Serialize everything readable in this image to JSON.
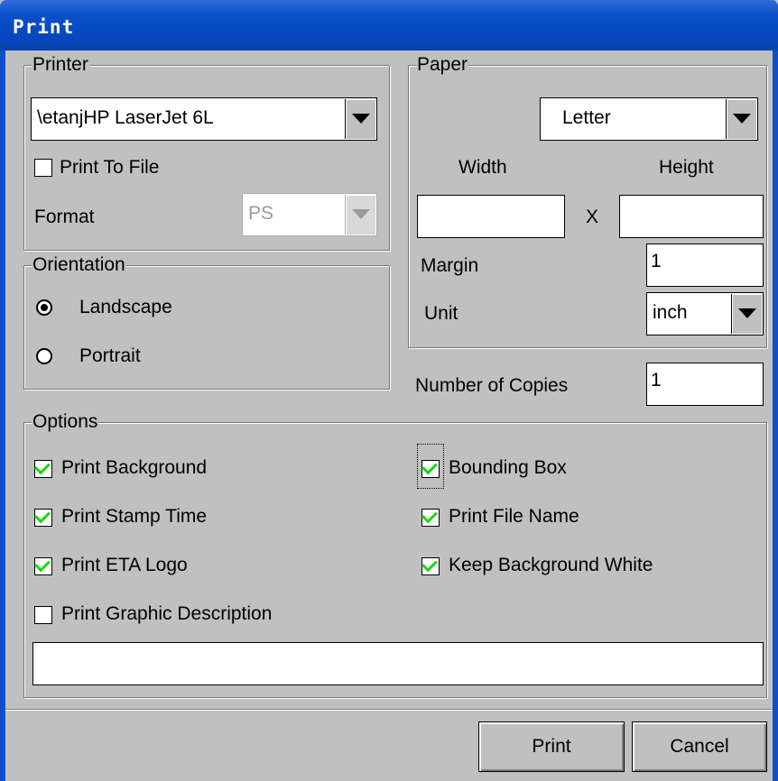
{
  "window": {
    "title": "Print"
  },
  "printer": {
    "legend": "Printer",
    "selected_printer": "\\etanjHP LaserJet 6L",
    "print_to_file_label": "Print To File",
    "print_to_file_checked": false,
    "format_label": "Format",
    "format_value": "PS"
  },
  "paper": {
    "legend": "Paper",
    "size_value": "Letter",
    "width_label": "Width",
    "height_label": "Height",
    "width_value": "",
    "height_value": "",
    "x_label": "X",
    "margin_label": "Margin",
    "margin_value": "1",
    "unit_label": "Unit",
    "unit_value": "inch"
  },
  "orientation": {
    "legend": "Orientation",
    "landscape_label": "Landscape",
    "portrait_label": "Portrait",
    "selected": "Landscape"
  },
  "copies": {
    "label": "Number of Copies",
    "value": "1"
  },
  "options": {
    "legend": "Options",
    "print_background": {
      "label": "Print Background",
      "checked": true
    },
    "print_stamp_time": {
      "label": "Print Stamp Time",
      "checked": true
    },
    "print_eta_logo": {
      "label": "Print ETA Logo",
      "checked": true
    },
    "print_graphic_description": {
      "label": "Print Graphic Description",
      "checked": false
    },
    "bounding_box": {
      "label": "Bounding Box",
      "checked": true
    },
    "print_file_name": {
      "label": "Print File Name",
      "checked": true
    },
    "keep_background_white": {
      "label": "Keep Background White",
      "checked": true
    },
    "description_value": ""
  },
  "buttons": {
    "print_label": "Print",
    "cancel_label": "Cancel"
  },
  "colors": {
    "title_bar": "#0a4fc8",
    "dialog_bg": "#c0c0c0",
    "check_mark": "#17d817"
  }
}
